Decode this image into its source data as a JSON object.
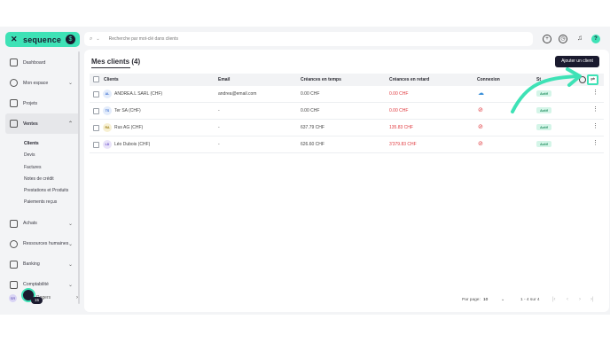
{
  "app": {
    "logo_text": "sequence",
    "logo_badge": "$",
    "accent": "#3ee2b6"
  },
  "sidebar": {
    "items": [
      {
        "label": "Dashboard",
        "icon": "home-icon"
      },
      {
        "label": "Mon espace",
        "icon": "user-icon",
        "chevron": "⌄"
      },
      {
        "label": "Projets",
        "icon": "check-square-icon"
      },
      {
        "label": "Ventes",
        "icon": "wallet-icon",
        "chevron": "⌃"
      },
      {
        "label": "Achats",
        "icon": "bag-icon",
        "chevron": "⌄"
      },
      {
        "label": "Ressources humaines",
        "icon": "people-icon",
        "chevron": "⌄"
      },
      {
        "label": "Banking",
        "icon": "bank-icon",
        "chevron": "⌄"
      },
      {
        "label": "Comptabilité",
        "icon": "ledger-icon",
        "chevron": "⌄"
      }
    ],
    "subitems": [
      "Clients",
      "Devis",
      "Factures",
      "Notes de crédit",
      "Prestations et Produits",
      "Paiements reçus"
    ],
    "user": {
      "initials": "SR",
      "name": "Rogers",
      "count": "15"
    }
  },
  "search": {
    "placeholder": "Recherche par mot-clé dans clients"
  },
  "page": {
    "title": "Mes clients (4)",
    "add_button": "Ajouter un client"
  },
  "table": {
    "headers": [
      "Clients",
      "Email",
      "Créances en temps",
      "Créances en retard",
      "Connexion",
      "St"
    ],
    "rows": [
      {
        "initials": "AL",
        "ini_bg": "#e3ecfb",
        "ini_fg": "#3b6fd1",
        "client": "ANDREA.L SARL (CHF)",
        "email": "andrea@email.com",
        "on_time": "0.00 CHF",
        "late": "0.00 CHF",
        "connected": true,
        "status": "Actif"
      },
      {
        "initials": "TS",
        "ini_bg": "#e3ecfb",
        "ini_fg": "#3b6fd1",
        "client": "Ter SA (CHF)",
        "email": "-",
        "on_time": "0.00 CHF",
        "late": "0.00 CHF",
        "connected": false,
        "status": "Actif"
      },
      {
        "initials": "RA",
        "ini_bg": "#f7f0d2",
        "ini_fg": "#9a7b12",
        "client": "Rus AG (CHF)",
        "email": "-",
        "on_time": "637.79 CHF",
        "late": "135.83 CHF",
        "connected": false,
        "status": "Actif"
      },
      {
        "initials": "LD",
        "ini_bg": "#e9e3fa",
        "ini_fg": "#6a4fc9",
        "client": "Léo Dubois (CHF)",
        "email": "-",
        "on_time": "626.60 CHF",
        "late": "3'379.83 CHF",
        "connected": false,
        "status": "Actif"
      }
    ]
  },
  "pagination": {
    "per_page_label": "Par page:",
    "per_page_value": "10",
    "range": "1 - 4 sur 4",
    "first": "|‹",
    "prev": "‹",
    "next": "›",
    "last": "›|"
  },
  "icons": {
    "kebab": "⋮",
    "connected": "☁",
    "disconnected": "⊘",
    "columns": "⇌",
    "search": "⌕",
    "chevron_down": "⌄"
  }
}
